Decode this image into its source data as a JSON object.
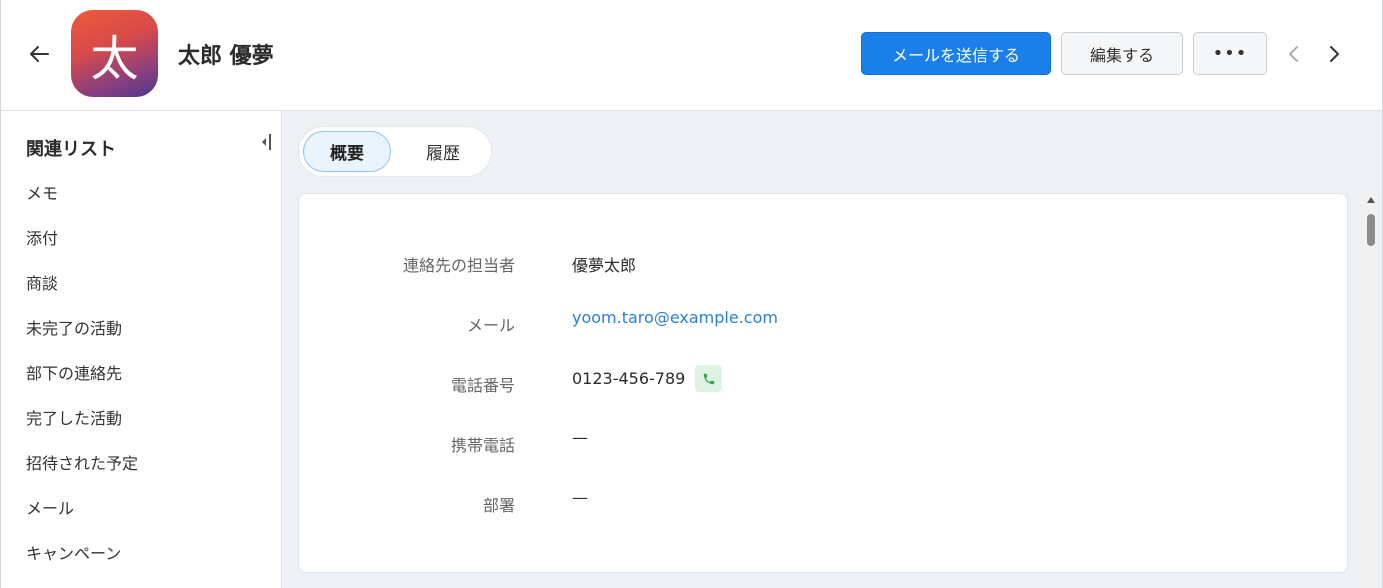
{
  "header": {
    "avatar_char": "太",
    "title": "太郎 優夢",
    "send_email_label": "メールを送信する",
    "edit_label": "編集する",
    "more_label": "•••"
  },
  "sidebar": {
    "title": "関連リスト",
    "items": [
      {
        "label": "メモ"
      },
      {
        "label": "添付"
      },
      {
        "label": "商談"
      },
      {
        "label": "未完了の活動"
      },
      {
        "label": "部下の連絡先"
      },
      {
        "label": "完了した活動"
      },
      {
        "label": "招待された予定"
      },
      {
        "label": "メール"
      },
      {
        "label": "キャンペーン"
      }
    ]
  },
  "tabs": [
    {
      "label": "概要",
      "active": true
    },
    {
      "label": "履歴",
      "active": false
    }
  ],
  "fields": [
    {
      "label": "連絡先の担当者",
      "value": "優夢太郎"
    },
    {
      "label": "メール",
      "value": "yoom.taro@example.com"
    },
    {
      "label": "電話番号",
      "value": "0123-456-789"
    },
    {
      "label": "携帯電話",
      "value": "—"
    },
    {
      "label": "部署",
      "value": "—"
    }
  ],
  "colors": {
    "primary": "#1a7fe8",
    "link": "#2b7fd6",
    "phone_icon": "#2faa4e",
    "main_bg": "#edf0f4"
  }
}
